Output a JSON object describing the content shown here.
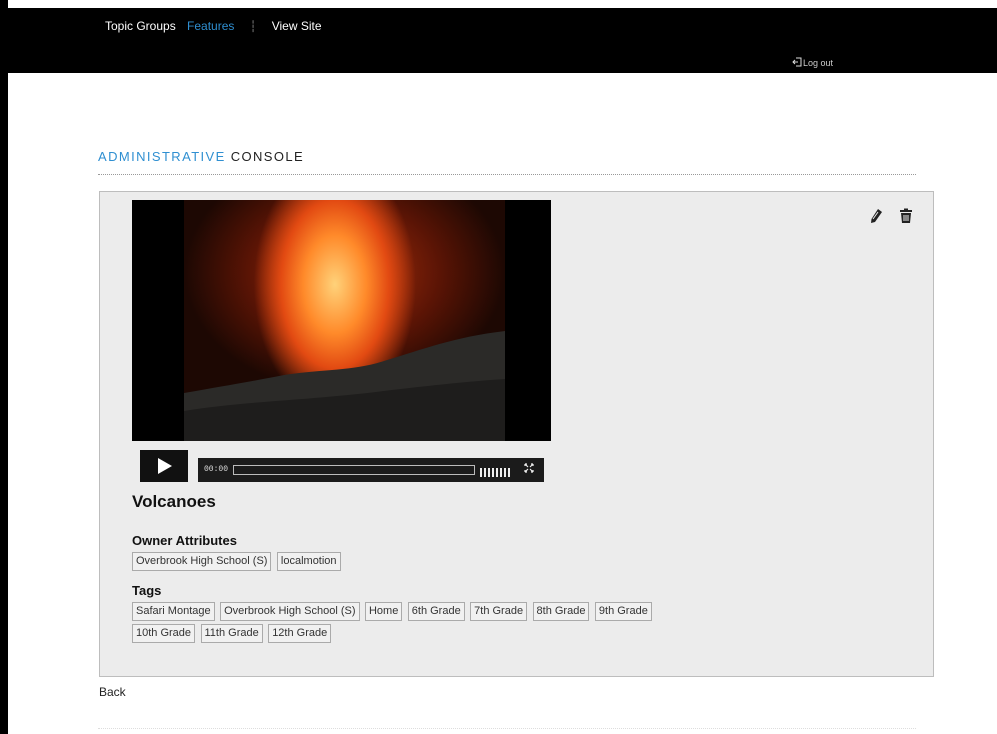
{
  "nav": {
    "items": [
      {
        "label": "Topic Groups"
      },
      {
        "label": "Features"
      },
      {
        "label": "View Site"
      }
    ],
    "active": "Features",
    "logout_label": "Log out"
  },
  "console": {
    "title_part1": "ADMINISTRATIVE",
    "title_part2": "CONSOLE"
  },
  "video": {
    "time": "00:00",
    "title": "Volcanoes"
  },
  "owner": {
    "label": "Owner Attributes",
    "items": [
      "Overbrook High School (S)",
      "localmotion"
    ]
  },
  "tags": {
    "label": "Tags",
    "row1": [
      "Safari Montage",
      "Overbrook High School (S)",
      "Home",
      "6th Grade",
      "7th Grade",
      "8th Grade",
      "9th Grade"
    ],
    "row2": [
      "10th Grade",
      "11th Grade",
      "12th Grade"
    ]
  },
  "back_label": "Back",
  "icons": [
    "edit-icon",
    "trash-icon",
    "play-icon",
    "fullscreen-icon",
    "logout-icon"
  ],
  "colors": {
    "accent": "#2f8fd1",
    "topbar": "#000000",
    "panel": "#ececec"
  }
}
